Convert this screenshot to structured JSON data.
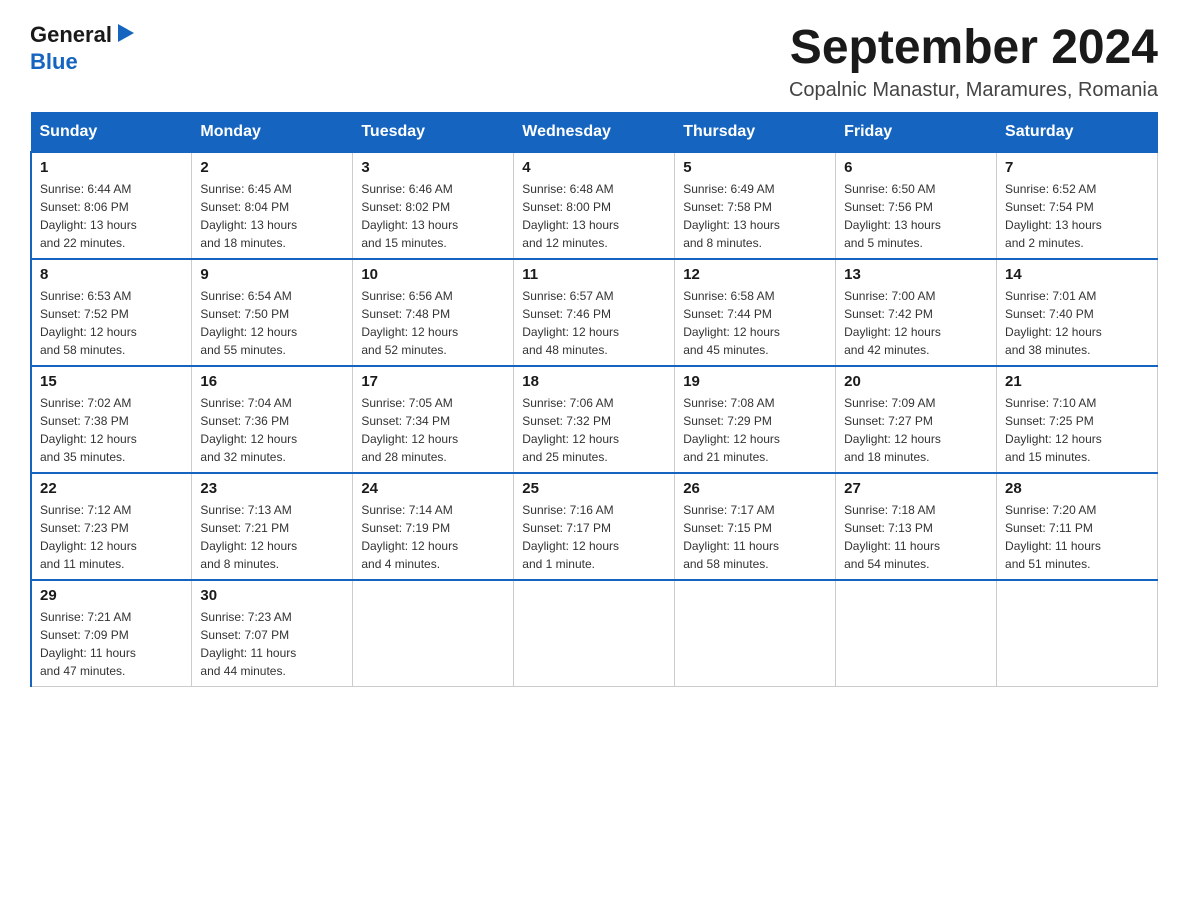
{
  "header": {
    "logo_general": "General",
    "logo_blue": "Blue",
    "month_title": "September 2024",
    "location": "Copalnic Manastur, Maramures, Romania"
  },
  "days_of_week": [
    "Sunday",
    "Monday",
    "Tuesday",
    "Wednesday",
    "Thursday",
    "Friday",
    "Saturday"
  ],
  "weeks": [
    [
      {
        "day": "1",
        "sunrise": "6:44 AM",
        "sunset": "8:06 PM",
        "daylight": "13 hours and 22 minutes."
      },
      {
        "day": "2",
        "sunrise": "6:45 AM",
        "sunset": "8:04 PM",
        "daylight": "13 hours and 18 minutes."
      },
      {
        "day": "3",
        "sunrise": "6:46 AM",
        "sunset": "8:02 PM",
        "daylight": "13 hours and 15 minutes."
      },
      {
        "day": "4",
        "sunrise": "6:48 AM",
        "sunset": "8:00 PM",
        "daylight": "13 hours and 12 minutes."
      },
      {
        "day": "5",
        "sunrise": "6:49 AM",
        "sunset": "7:58 PM",
        "daylight": "13 hours and 8 minutes."
      },
      {
        "day": "6",
        "sunrise": "6:50 AM",
        "sunset": "7:56 PM",
        "daylight": "13 hours and 5 minutes."
      },
      {
        "day": "7",
        "sunrise": "6:52 AM",
        "sunset": "7:54 PM",
        "daylight": "13 hours and 2 minutes."
      }
    ],
    [
      {
        "day": "8",
        "sunrise": "6:53 AM",
        "sunset": "7:52 PM",
        "daylight": "12 hours and 58 minutes."
      },
      {
        "day": "9",
        "sunrise": "6:54 AM",
        "sunset": "7:50 PM",
        "daylight": "12 hours and 55 minutes."
      },
      {
        "day": "10",
        "sunrise": "6:56 AM",
        "sunset": "7:48 PM",
        "daylight": "12 hours and 52 minutes."
      },
      {
        "day": "11",
        "sunrise": "6:57 AM",
        "sunset": "7:46 PM",
        "daylight": "12 hours and 48 minutes."
      },
      {
        "day": "12",
        "sunrise": "6:58 AM",
        "sunset": "7:44 PM",
        "daylight": "12 hours and 45 minutes."
      },
      {
        "day": "13",
        "sunrise": "7:00 AM",
        "sunset": "7:42 PM",
        "daylight": "12 hours and 42 minutes."
      },
      {
        "day": "14",
        "sunrise": "7:01 AM",
        "sunset": "7:40 PM",
        "daylight": "12 hours and 38 minutes."
      }
    ],
    [
      {
        "day": "15",
        "sunrise": "7:02 AM",
        "sunset": "7:38 PM",
        "daylight": "12 hours and 35 minutes."
      },
      {
        "day": "16",
        "sunrise": "7:04 AM",
        "sunset": "7:36 PM",
        "daylight": "12 hours and 32 minutes."
      },
      {
        "day": "17",
        "sunrise": "7:05 AM",
        "sunset": "7:34 PM",
        "daylight": "12 hours and 28 minutes."
      },
      {
        "day": "18",
        "sunrise": "7:06 AM",
        "sunset": "7:32 PM",
        "daylight": "12 hours and 25 minutes."
      },
      {
        "day": "19",
        "sunrise": "7:08 AM",
        "sunset": "7:29 PM",
        "daylight": "12 hours and 21 minutes."
      },
      {
        "day": "20",
        "sunrise": "7:09 AM",
        "sunset": "7:27 PM",
        "daylight": "12 hours and 18 minutes."
      },
      {
        "day": "21",
        "sunrise": "7:10 AM",
        "sunset": "7:25 PM",
        "daylight": "12 hours and 15 minutes."
      }
    ],
    [
      {
        "day": "22",
        "sunrise": "7:12 AM",
        "sunset": "7:23 PM",
        "daylight": "12 hours and 11 minutes."
      },
      {
        "day": "23",
        "sunrise": "7:13 AM",
        "sunset": "7:21 PM",
        "daylight": "12 hours and 8 minutes."
      },
      {
        "day": "24",
        "sunrise": "7:14 AM",
        "sunset": "7:19 PM",
        "daylight": "12 hours and 4 minutes."
      },
      {
        "day": "25",
        "sunrise": "7:16 AM",
        "sunset": "7:17 PM",
        "daylight": "12 hours and 1 minute."
      },
      {
        "day": "26",
        "sunrise": "7:17 AM",
        "sunset": "7:15 PM",
        "daylight": "11 hours and 58 minutes."
      },
      {
        "day": "27",
        "sunrise": "7:18 AM",
        "sunset": "7:13 PM",
        "daylight": "11 hours and 54 minutes."
      },
      {
        "day": "28",
        "sunrise": "7:20 AM",
        "sunset": "7:11 PM",
        "daylight": "11 hours and 51 minutes."
      }
    ],
    [
      {
        "day": "29",
        "sunrise": "7:21 AM",
        "sunset": "7:09 PM",
        "daylight": "11 hours and 47 minutes."
      },
      {
        "day": "30",
        "sunrise": "7:23 AM",
        "sunset": "7:07 PM",
        "daylight": "11 hours and 44 minutes."
      },
      null,
      null,
      null,
      null,
      null
    ]
  ],
  "sunrise_label": "Sunrise:",
  "sunset_label": "Sunset:",
  "daylight_label": "Daylight:"
}
